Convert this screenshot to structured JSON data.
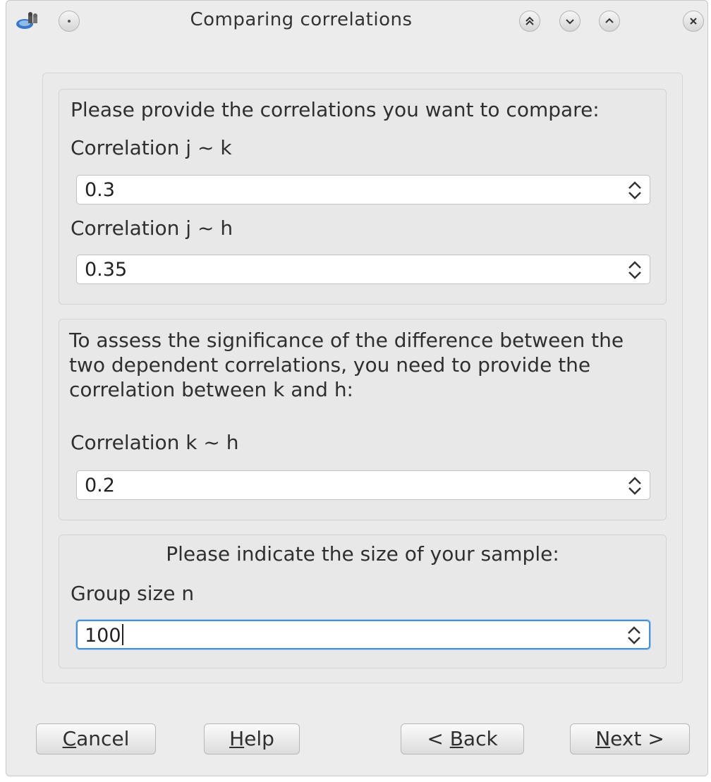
{
  "window": {
    "title": "Comparing correlations"
  },
  "titlebar": {
    "icons": [
      "app-icon",
      "menu-circle-icon",
      "keep-above-icon",
      "minimize-icon",
      "maximize-icon",
      "close-icon"
    ]
  },
  "section_correlations": {
    "heading": "Please provide the correlations you want to compare:",
    "jk_label": "Correlation j ~ k",
    "jk_value": "0.3",
    "jh_label": "Correlation j ~ h",
    "jh_value": "0.35"
  },
  "section_dependent": {
    "text": "To assess the significance of the difference between the two dependent correlations, you need to provide the correlation between k and h:",
    "kh_label": "Correlation k ~ h",
    "kh_value": "0.2"
  },
  "section_sample": {
    "heading": "Please indicate the size of your sample:",
    "n_label": "Group size n",
    "n_value": "100"
  },
  "buttons": {
    "cancel": {
      "mnemonic": "C",
      "rest": "ancel"
    },
    "help": {
      "mnemonic": "H",
      "rest": "elp"
    },
    "back": {
      "prefix": "< ",
      "mnemonic": "B",
      "rest": "ack"
    },
    "next": {
      "mnemonic": "N",
      "rest": "ext >"
    }
  }
}
